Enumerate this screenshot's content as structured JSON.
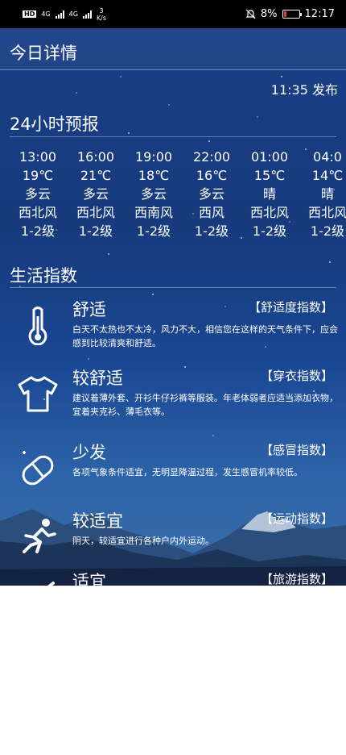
{
  "statusbar": {
    "hd1": "HD",
    "net1": "4G",
    "net2": "4G",
    "speed_val": "3",
    "speed_unit": "K/s",
    "battery": "8%",
    "time": "12:17"
  },
  "appbar": {
    "title": "今日详情"
  },
  "published": "11:35 发布",
  "forecast": {
    "title": "24小时预报",
    "hours": [
      {
        "time": "13:00",
        "temp": "19℃",
        "weather": "多云",
        "wind_dir": "西北风",
        "wind_level": "1-2级"
      },
      {
        "time": "16:00",
        "temp": "21℃",
        "weather": "多云",
        "wind_dir": "西北风",
        "wind_level": "1-2级"
      },
      {
        "time": "19:00",
        "temp": "18℃",
        "weather": "多云",
        "wind_dir": "西南风",
        "wind_level": "1-2级"
      },
      {
        "time": "22:00",
        "temp": "16℃",
        "weather": "多云",
        "wind_dir": "西风",
        "wind_level": "1-2级"
      },
      {
        "time": "01:00",
        "temp": "15℃",
        "weather": "晴",
        "wind_dir": "西北风",
        "wind_level": "1-2级"
      },
      {
        "time": "04:0",
        "temp": "14℃",
        "weather": "晴",
        "wind_dir": "西北风",
        "wind_level": "1-2级"
      }
    ]
  },
  "life": {
    "title": "生活指数",
    "items": [
      {
        "icon": "thermometer-icon",
        "level": "舒适",
        "category": "【舒适度指数】",
        "desc": "白天不太热也不太冷，风力不大，相信您在这样的天气条件下，应会感到比较清爽和舒适。"
      },
      {
        "icon": "tshirt-icon",
        "level": "较舒适",
        "category": "【穿衣指数】",
        "desc": "建议着薄外套、开衫牛仔衫裤等服装。年老体弱者应适当添加衣物，宜着夹克衫、薄毛衣等。"
      },
      {
        "icon": "pill-icon",
        "level": "少发",
        "category": "【感冒指数】",
        "desc": "各项气象条件适宜，无明显降温过程，发生感冒机率较低。"
      },
      {
        "icon": "running-icon",
        "level": "较适宜",
        "category": "【运动指数】",
        "desc": "阴天，较适宜进行各种户内外运动。"
      },
      {
        "icon": "plane-icon",
        "level": "适宜",
        "category": "【旅游指数】",
        "desc": ""
      }
    ]
  }
}
